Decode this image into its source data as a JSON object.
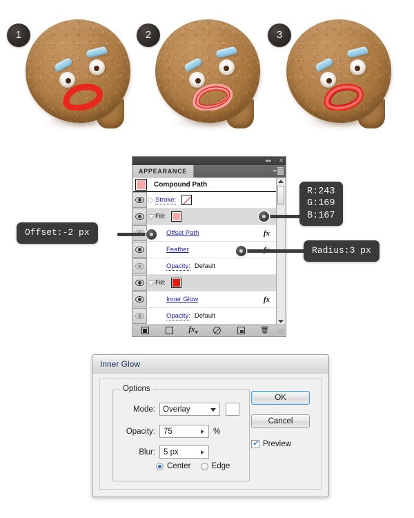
{
  "tutorial": {
    "steps": [
      {
        "badge": "1",
        "name": "cookie-face-step-1",
        "mouth_style": "solid-red"
      },
      {
        "badge": "2",
        "name": "cookie-face-step-2",
        "mouth_style": "light-outline"
      },
      {
        "badge": "3",
        "name": "cookie-face-step-3",
        "mouth_style": "outline-glow"
      }
    ]
  },
  "appearance_panel": {
    "titlebar": {
      "collapse_icon": "◂◂",
      "close_icon": "✕",
      "separator": "|"
    },
    "tab_label": "APPEARANCE",
    "header": {
      "title": "Compound Path",
      "swatch_color": "#F3A9A7"
    },
    "rows": [
      {
        "label": "Stroke:",
        "label_style": "dotted",
        "disclosure": "right",
        "swatch": "none",
        "eye": "on",
        "fx": false,
        "selected": false,
        "indent": false,
        "value": ""
      },
      {
        "label": "Fill:",
        "label_style": "plain",
        "disclosure": "down",
        "swatch": "#F3A9A7",
        "eye": "on",
        "fx": false,
        "selected": true,
        "indent": false,
        "value": ""
      },
      {
        "label": "Offset Path",
        "label_style": "link",
        "disclosure": "none",
        "swatch": "",
        "eye": "dim",
        "fx": true,
        "selected": false,
        "indent": true,
        "value": ""
      },
      {
        "label": "Feather",
        "label_style": "link",
        "disclosure": "none",
        "swatch": "",
        "eye": "on",
        "fx": true,
        "selected": false,
        "indent": true,
        "value": ""
      },
      {
        "label": "Opacity:",
        "label_style": "dotted",
        "disclosure": "none",
        "swatch": "",
        "eye": "dim",
        "fx": false,
        "selected": false,
        "indent": true,
        "value": "Default"
      },
      {
        "label": "Fill:",
        "label_style": "plain",
        "disclosure": "down",
        "swatch": "#E21E19",
        "eye": "on",
        "fx": false,
        "selected": true,
        "indent": false,
        "value": ""
      },
      {
        "label": "Inner Glow",
        "label_style": "link",
        "disclosure": "none",
        "swatch": "",
        "eye": "on",
        "fx": true,
        "selected": false,
        "indent": true,
        "value": ""
      },
      {
        "label": "Opacity:",
        "label_style": "dotted",
        "disclosure": "none",
        "swatch": "",
        "eye": "dim",
        "fx": false,
        "selected": false,
        "indent": true,
        "value": "Default"
      }
    ],
    "footer_buttons": [
      {
        "icon": "add-new-stroke-icon"
      },
      {
        "icon": "add-new-fill-icon"
      },
      {
        "icon": "add-new-effect-icon"
      },
      {
        "icon": "clear-appearance-icon"
      },
      {
        "icon": "duplicate-item-icon"
      },
      {
        "icon": "delete-item-icon"
      }
    ]
  },
  "callouts": {
    "rgb": "R:243\nG:169\nB:167",
    "offset": "Offset:-2 px",
    "radius": "Radius:3 px"
  },
  "inner_glow_dialog": {
    "title": "Inner Glow",
    "options_legend": "Options",
    "mode_label": "Mode:",
    "mode_value": "Overlay",
    "glow_color": "#FFFFFF",
    "opacity_label": "Opacity:",
    "opacity_value": "75",
    "opacity_unit": "%",
    "blur_label": "Blur:",
    "blur_value": "5 px",
    "center_label": "Center",
    "edge_label": "Edge",
    "selected_origin": "Center",
    "ok_label": "OK",
    "cancel_label": "Cancel",
    "preview_label": "Preview",
    "preview_checked": true,
    "check_glyph": "✔"
  }
}
